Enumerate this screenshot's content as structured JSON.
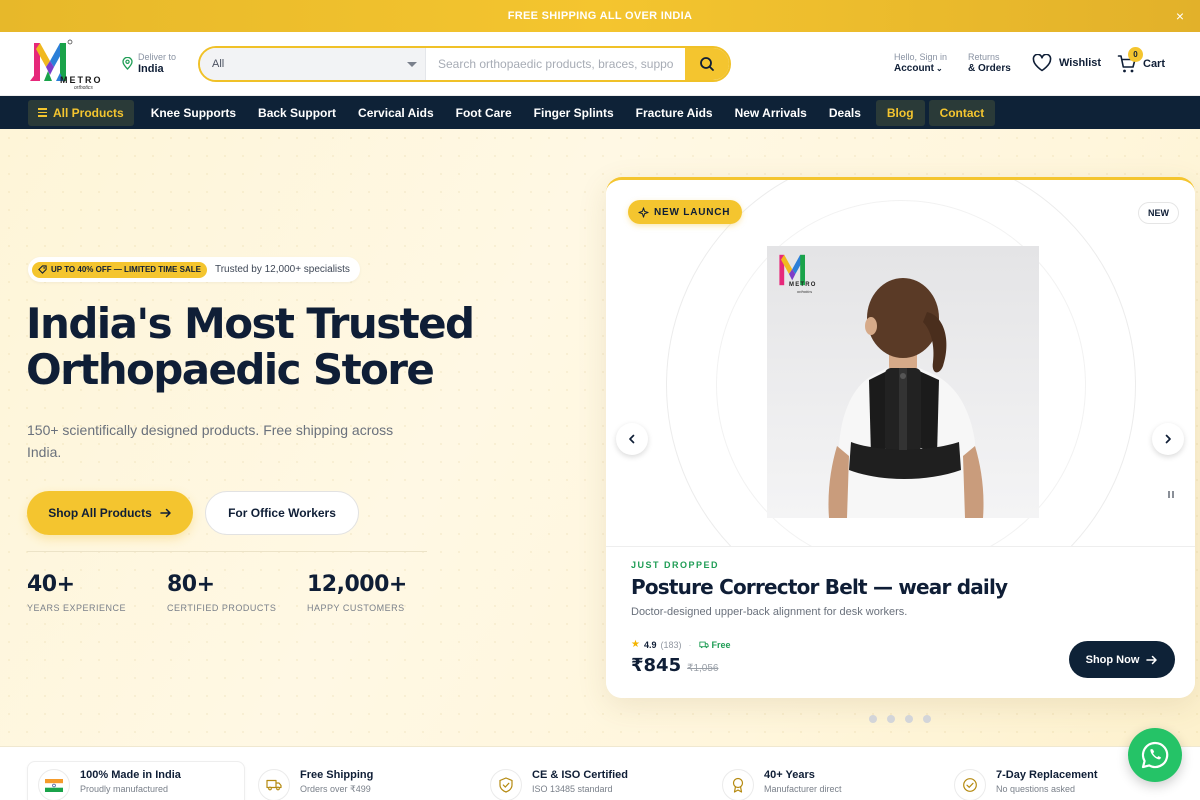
{
  "promo": {
    "text": "FREE SHIPPING ALL OVER INDIA",
    "close": "×"
  },
  "header": {
    "logo": {
      "word": "METRO",
      "sub": "orthotics"
    },
    "deliver": {
      "label": "Deliver to",
      "value": "India"
    },
    "search": {
      "category": "All",
      "placeholder": "Search orthopaedic products, braces, supports..."
    },
    "account": {
      "hello": "Hello, Sign in",
      "label": "Account"
    },
    "returns": {
      "label": "Returns",
      "value": "& Orders"
    },
    "wishlist": "Wishlist",
    "cart": {
      "label": "Cart",
      "count": "0"
    }
  },
  "nav": {
    "all_products": "All Products",
    "items": [
      "Knee Supports",
      "Back Support",
      "Cervical Aids",
      "Foot Care",
      "Finger Splints",
      "Fracture Aids",
      "New Arrivals",
      "Deals"
    ],
    "blog": "Blog",
    "contact": "Contact"
  },
  "hero": {
    "sale_tag": "UP TO 40% OFF — LIMITED TIME SALE",
    "trust": "Trusted by 12,000+ specialists",
    "title_line1": "India's Most Trusted",
    "title_line2": "Orthopaedic Store",
    "subtitle": "150+ scientifically designed products. Free shipping across India.",
    "cta_primary": "Shop All Products",
    "cta_secondary": "For Office Workers",
    "stats": [
      {
        "value": "40+",
        "label": "YEARS EXPERIENCE"
      },
      {
        "value": "80+",
        "label": "CERTIFIED PRODUCTS"
      },
      {
        "value": "12,000+",
        "label": "HAPPY CUSTOMERS"
      }
    ]
  },
  "product": {
    "launch_badge": "NEW LAUNCH",
    "new_badge": "NEW",
    "image_logo": "METRO",
    "image_logo_sub": "orthotics",
    "eyebrow": "JUST DROPPED",
    "title": "Posture Corrector Belt — wear daily",
    "description": "Doctor-designed upper-back alignment for desk workers.",
    "rating": "4.9",
    "reviews": "(183)",
    "shipping": "Free",
    "price": "₹845",
    "old_price": "₹1,056",
    "cta": "Shop Now",
    "slides": 4,
    "active_slide": 0
  },
  "trust_strip": [
    {
      "title": "100% Made in India",
      "sub": "Proudly manufactured",
      "icon": "india-flag-icon"
    },
    {
      "title": "Free Shipping",
      "sub": "Orders over ₹499",
      "icon": "truck-icon"
    },
    {
      "title": "CE & ISO Certified",
      "sub": "ISO 13485 standard",
      "icon": "shield-check-icon"
    },
    {
      "title": "40+ Years",
      "sub": "Manufacturer direct",
      "icon": "award-icon"
    },
    {
      "title": "7-Day Replacement",
      "sub": "No questions asked",
      "icon": "check-circle-icon"
    }
  ],
  "colors": {
    "accent": "#f4c52f",
    "navy": "#0e2237",
    "green": "#1f9d55",
    "whatsapp": "#25c367"
  }
}
